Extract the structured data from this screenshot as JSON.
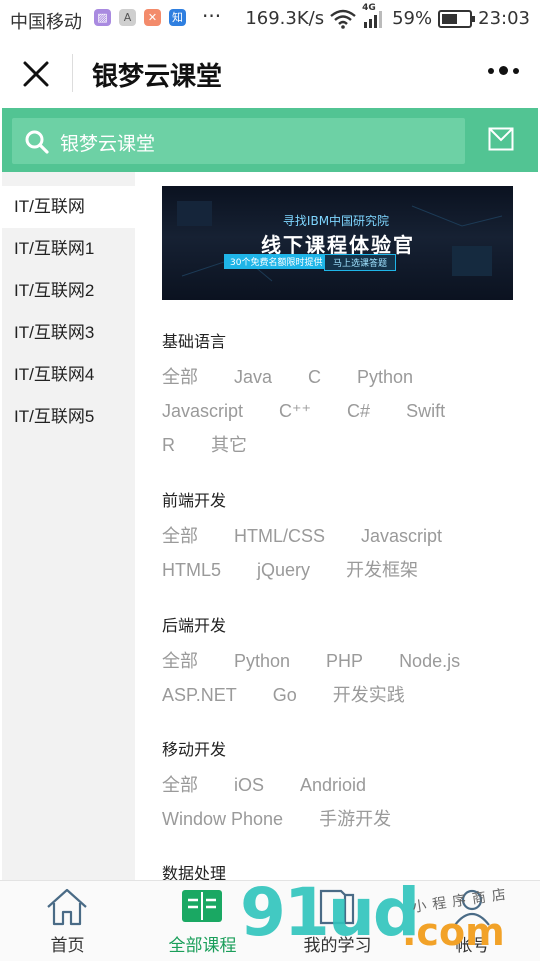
{
  "status_bar": {
    "carrier": "中国移动",
    "more": "···",
    "network_speed": "169.3K/s",
    "network_type": "4G",
    "battery": "59%",
    "battery_level": 0.59,
    "time": "23:03",
    "app_icons": [
      {
        "name": "gallery-app-icon",
        "color": "#a98ae0",
        "glyph": "▨"
      },
      {
        "name": "font-app-icon",
        "color": "#cfcfcf",
        "glyph": "A"
      },
      {
        "name": "tool-app-icon",
        "color": "#f38b6b",
        "glyph": "✕"
      },
      {
        "name": "zhihu-app-icon",
        "color": "#2f7fe0",
        "glyph": "知"
      }
    ]
  },
  "navbar": {
    "title": "银梦云课堂"
  },
  "search": {
    "placeholder": "银梦云课堂",
    "accent_color": "#52c493"
  },
  "sidebar": {
    "items": [
      {
        "label": "IT/互联网",
        "active": true
      },
      {
        "label": "IT/互联网1"
      },
      {
        "label": "IT/互联网2"
      },
      {
        "label": "IT/互联网3"
      },
      {
        "label": "IT/互联网4"
      },
      {
        "label": "IT/互联网5"
      }
    ]
  },
  "banner": {
    "line1": "寻找IBM中国研究院",
    "line2": "线下课程体验官",
    "pill1": "30个免费名额限时提供",
    "pill2": "马上选课答题"
  },
  "sections": [
    {
      "title": "基础语言",
      "tags": [
        "全部",
        "Java",
        "C",
        "Python",
        "Javascript",
        "C⁺⁺",
        "C#",
        "Swift",
        "R",
        "其它"
      ]
    },
    {
      "title": "前端开发",
      "tags": [
        "全部",
        "HTML/CSS",
        "Javascript",
        "HTML5",
        "jQuery",
        "开发框架"
      ]
    },
    {
      "title": "后端开发",
      "tags": [
        "全部",
        "Python",
        "PHP",
        "Node.js",
        "ASP.NET",
        "Go",
        "开发实践"
      ]
    },
    {
      "title": "移动开发",
      "tags": [
        "全部",
        "iOS",
        "Andrioid",
        "Window Phone",
        "手游开发"
      ]
    },
    {
      "title": "数据处理",
      "tags": []
    }
  ],
  "tabbar": {
    "tabs": [
      {
        "label": "首页",
        "icon": "home-icon"
      },
      {
        "label": "全部课程",
        "icon": "courses-icon",
        "active": true
      },
      {
        "label": "我的学习",
        "icon": "book-icon"
      },
      {
        "label": "帐号",
        "icon": "user-icon"
      }
    ],
    "active_color": "#1a9e5a"
  },
  "watermark": {
    "main": "91ud",
    "suffix": ".com",
    "tagline": "小程序商店"
  }
}
